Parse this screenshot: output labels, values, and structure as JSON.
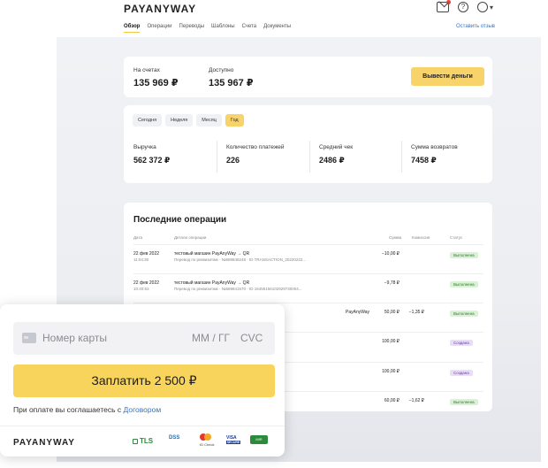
{
  "header": {
    "logo": "PAYANYWAY",
    "nav": [
      "Обзор",
      "Операции",
      "Переводы",
      "Шаблоны",
      "Счета",
      "Документы"
    ],
    "feedback": "Оставить отзыв"
  },
  "balance": {
    "accounts_label": "На счетах",
    "accounts_value": "135 969 ₽",
    "available_label": "Доступно",
    "available_value": "135 967 ₽",
    "withdraw_label": "Вывести деньги"
  },
  "stats": {
    "periods": [
      "Сегодня",
      "Неделя",
      "Месяц",
      "Год"
    ],
    "active_period": "Год",
    "items": [
      {
        "label": "Выручка",
        "value": "562 372 ₽"
      },
      {
        "label": "Количество платежей",
        "value": "226"
      },
      {
        "label": "Средний чек",
        "value": "2486 ₽"
      },
      {
        "label": "Сумма возвратов",
        "value": "7458 ₽"
      }
    ]
  },
  "operations": {
    "title": "Последние операции",
    "columns": [
      "Дата",
      "Детали операции",
      "Сумма",
      "Комиссия",
      "Статус"
    ],
    "rows": [
      {
        "date": "22 фев 2022",
        "time": "11:04:30",
        "shop": "тестовый магазин PayAnyWay → QR",
        "sub": "Перевод по реквизитам · №589848248 · ID TRANSACTION_20220222...",
        "amount": "−10,00 ₽",
        "fee": "",
        "status": "Выполнена"
      },
      {
        "date": "22 фев 2022",
        "time": "10:40:53",
        "shop": "тестовый магазин PayAnyWay → QR",
        "sub": "Перевод по реквизитам · №589841570 · ID 1645515610292973000​4...",
        "amount": "−9,78 ₽",
        "fee": "",
        "status": "Выполнена"
      },
      {
        "date": "",
        "time": "",
        "shop": "PayAnyWay",
        "sub": "",
        "amount": "50,00 ₽",
        "fee": "−1,35 ₽",
        "status": "Выполнена"
      },
      {
        "date": "",
        "time": "",
        "shop": "",
        "sub": "",
        "amount": "100,00 ₽",
        "fee": "",
        "status": "Создана"
      },
      {
        "date": "",
        "time": "",
        "shop": "",
        "sub": "",
        "amount": "100,00 ₽",
        "fee": "",
        "status": "Создана"
      },
      {
        "date": "",
        "time": "",
        "shop": "",
        "sub": "",
        "amount": "60,00 ₽",
        "fee": "−1,62 ₽",
        "status": "Выполнена"
      }
    ]
  },
  "payment": {
    "card_placeholder": "Номер карты",
    "expiry_placeholder": "ММ / ГГ",
    "cvc_placeholder": "CVC",
    "pay_button": "Заплатить 2 500 ₽",
    "agree_text": "При оплате вы соглашаетесь с ",
    "agree_link": "Договором",
    "logo": "PAYANYWAY",
    "trust": {
      "tls": "TLS",
      "pci": "DSS",
      "mastercard": "ID Check",
      "visa": "VISA",
      "visa_sub": "SECURE",
      "mir": "MIR"
    }
  }
}
